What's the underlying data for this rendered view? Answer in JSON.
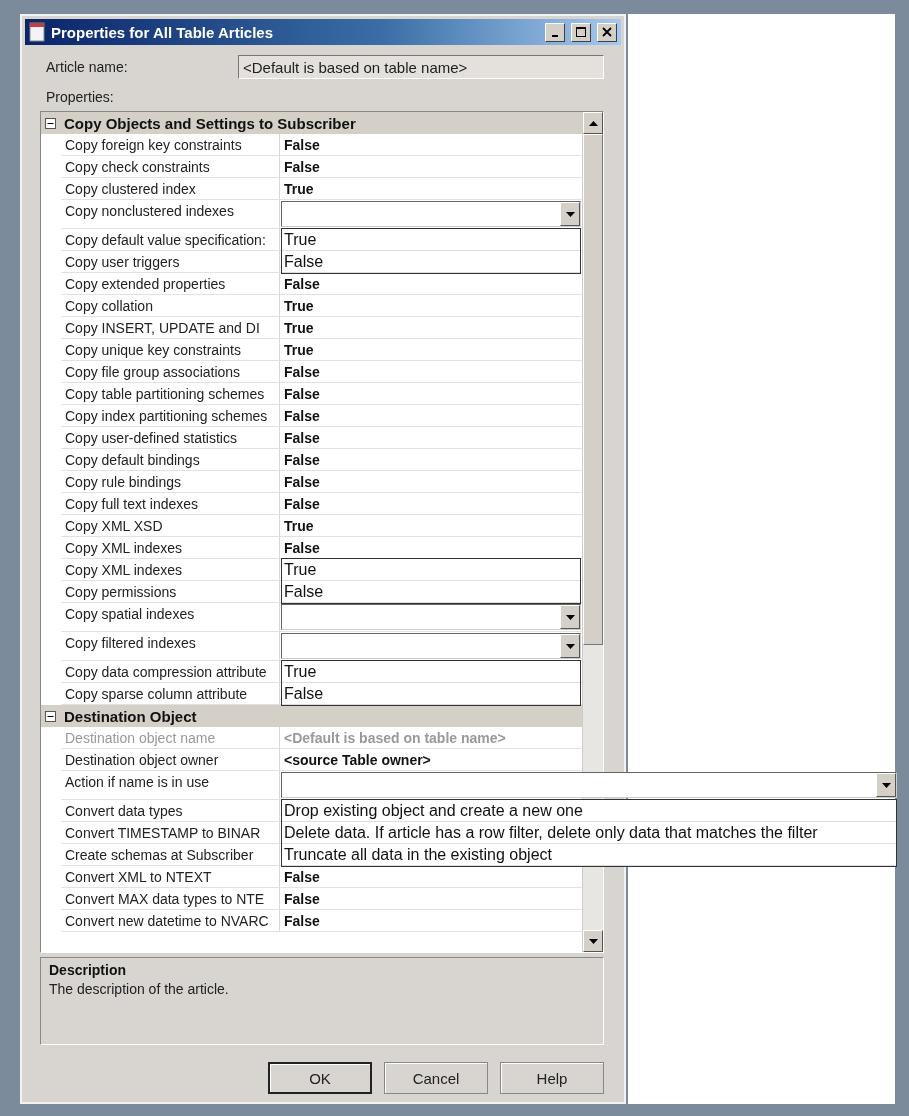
{
  "window": {
    "title": "Properties for All Table Articles"
  },
  "article_name": {
    "label": "Article name:",
    "value": "<Default is based on table name>"
  },
  "properties_label": "Properties:",
  "groups": [
    {
      "title": "Copy Objects and Settings to Subscriber",
      "expanded": true,
      "rows": [
        {
          "name": "Copy foreign key constraints",
          "kind": "value",
          "value": "False",
          "disabled": false
        },
        {
          "name": "Copy check constraints",
          "kind": "value",
          "value": "False",
          "disabled": false
        },
        {
          "name": "Copy clustered index",
          "kind": "value",
          "value": "True",
          "disabled": false
        },
        {
          "name": "Copy nonclustered indexes",
          "kind": "combo",
          "disabled": false,
          "options": [
            "True",
            "False"
          ],
          "wide": false
        },
        {
          "name": "Copy default value specification:",
          "kind": "covered",
          "disabled": false
        },
        {
          "name": "Copy user triggers",
          "kind": "covered",
          "disabled": false
        },
        {
          "name": "Copy extended properties",
          "kind": "value",
          "value": "False",
          "disabled": false
        },
        {
          "name": "Copy collation",
          "kind": "value",
          "value": "True",
          "disabled": false
        },
        {
          "name": "Copy INSERT, UPDATE and DI",
          "kind": "value",
          "value": "True",
          "disabled": false
        },
        {
          "name": "Copy unique key constraints",
          "kind": "value",
          "value": "True",
          "disabled": false
        },
        {
          "name": "Copy file group associations",
          "kind": "value",
          "value": "False",
          "disabled": false
        },
        {
          "name": "Copy table partitioning schemes",
          "kind": "value",
          "value": "False",
          "disabled": false
        },
        {
          "name": "Copy index partitioning schemes",
          "kind": "value",
          "value": "False",
          "disabled": false
        },
        {
          "name": "Copy user-defined statistics",
          "kind": "value",
          "value": "False",
          "disabled": false
        },
        {
          "name": "Copy default bindings",
          "kind": "value",
          "value": "False",
          "disabled": false
        },
        {
          "name": "Copy rule bindings",
          "kind": "value",
          "value": "False",
          "disabled": false
        },
        {
          "name": "Copy full text indexes",
          "kind": "value",
          "value": "False",
          "disabled": false
        },
        {
          "name": "Copy XML XSD",
          "kind": "value",
          "value": "True",
          "disabled": false
        },
        {
          "name": "Copy XML indexes",
          "kind": "value",
          "value": "False",
          "disabled": false,
          "options": [
            "True",
            "False"
          ],
          "wide": false
        },
        {
          "name": "Copy XML indexes",
          "kind": "covered",
          "disabled": false
        },
        {
          "name": "Copy permissions",
          "kind": "covered",
          "disabled": false
        },
        {
          "name": "Copy spatial indexes",
          "kind": "combo",
          "disabled": false
        },
        {
          "name": "Copy filtered indexes",
          "kind": "combo",
          "disabled": false,
          "options": [
            "True",
            "False"
          ],
          "wide": false
        },
        {
          "name": "Copy data compression attribute",
          "kind": "covered",
          "disabled": false
        },
        {
          "name": "Copy sparse column attribute",
          "kind": "covered",
          "disabled": false
        }
      ]
    },
    {
      "title": "Destination Object",
      "expanded": true,
      "rows": [
        {
          "name": "Destination object name",
          "kind": "value",
          "value": "<Default is based on table name>",
          "disabled": true
        },
        {
          "name": "Destination object owner",
          "kind": "value",
          "value": "<source Table owner>",
          "disabled": false
        },
        {
          "name": "Action if name is in use",
          "kind": "combo",
          "disabled": false,
          "options": [
            "Drop existing object and create a new one",
            "Delete data. If article has a row filter, delete only data that matches the filter",
            "Truncate all data in the existing object"
          ],
          "wide": true
        },
        {
          "name": "Convert data types",
          "kind": "covered",
          "disabled": false
        },
        {
          "name": "Convert TIMESTAMP to BINAR",
          "kind": "covered",
          "disabled": false
        },
        {
          "name": "Create schemas at Subscriber",
          "kind": "covered",
          "disabled": false
        },
        {
          "name": "Convert XML to NTEXT",
          "kind": "value",
          "value": "False",
          "disabled": false
        },
        {
          "name": "Convert MAX data types to NTE",
          "kind": "value",
          "value": "False",
          "disabled": false
        },
        {
          "name": "Convert new datetime to NVARC",
          "kind": "value",
          "value": "False",
          "disabled": false
        }
      ]
    }
  ],
  "description": {
    "title": "Description",
    "text": "The description of the article."
  },
  "buttons": [
    {
      "label": "OK",
      "default": true
    },
    {
      "label": "Cancel",
      "default": false
    },
    {
      "label": "Help",
      "default": false
    }
  ]
}
